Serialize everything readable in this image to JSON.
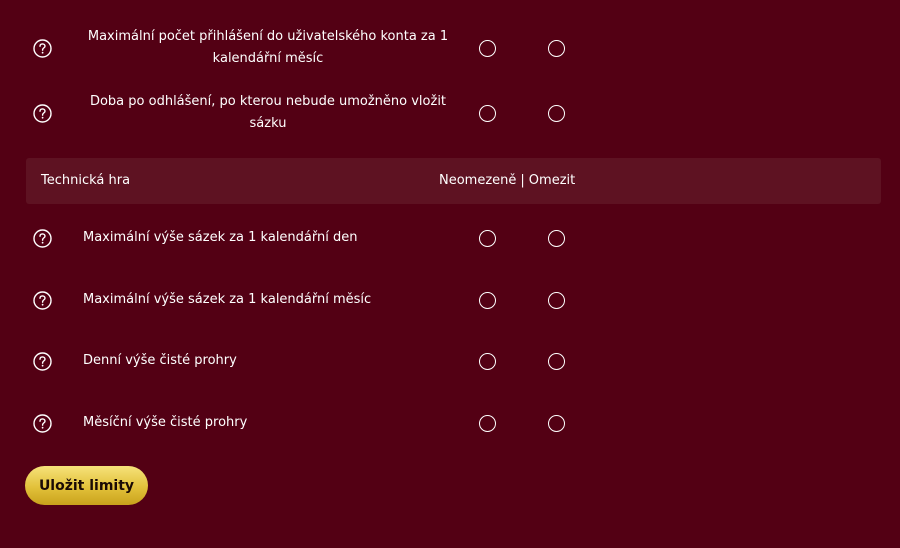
{
  "rows_top": [
    {
      "label": "Maximální počet přihlášení do uživatelského konta za 1 kalendářní měsíc"
    },
    {
      "label": "Doba po odhlášení, po kterou nebude umožněno vložit sázku"
    }
  ],
  "section": {
    "title": "Technická hra",
    "col_unlimited": "Neomezeně",
    "col_separator": "|",
    "col_limited": "Omezit"
  },
  "rows_section": [
    {
      "label": "Maximální výše sázek za 1 kalendářní den"
    },
    {
      "label": "Maximální výše sázek za 1 kalendářní měsíc"
    },
    {
      "label": "Denní výše čisté prohry"
    },
    {
      "label": "Měsíční výše čisté prohry"
    }
  ],
  "save_button": {
    "label": "Uložit limity"
  },
  "icons": {
    "help": "question-circle-icon"
  },
  "colors": {
    "background": "#530014",
    "section_header": "#5e1222",
    "button_gold": "#e2c13a",
    "text": "#ffffff"
  }
}
